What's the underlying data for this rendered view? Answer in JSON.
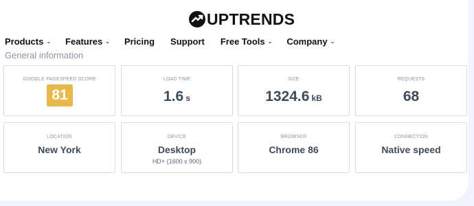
{
  "brand": {
    "name": "UPTRENDS"
  },
  "nav": {
    "items": [
      {
        "label": "Products",
        "dropdown": true
      },
      {
        "label": "Features",
        "dropdown": true
      },
      {
        "label": "Pricing",
        "dropdown": false
      },
      {
        "label": "Support",
        "dropdown": false
      },
      {
        "label": "Free Tools",
        "dropdown": true
      },
      {
        "label": "Company",
        "dropdown": true
      }
    ]
  },
  "section": {
    "title": "General information"
  },
  "metrics": {
    "pagespeed": {
      "label": "Google PageSpeed Score",
      "value": "81",
      "badge_color": "#e8b84a"
    },
    "load_time": {
      "label": "Load Time",
      "value": "1.6",
      "unit": "s"
    },
    "size": {
      "label": "Size",
      "value": "1324.6",
      "unit": "kB"
    },
    "requests": {
      "label": "Requests",
      "value": "68"
    },
    "location": {
      "label": "Location",
      "value": "New York"
    },
    "device": {
      "label": "Device",
      "value": "Desktop",
      "detail": "HD+ (1600 x 900)"
    },
    "browser": {
      "label": "Browser",
      "value": "Chrome 86"
    },
    "connection": {
      "label": "Connection",
      "value": "Native speed"
    }
  },
  "colors": {
    "value_text": "#3c4a5c",
    "label_text": "#8b95a1",
    "background": "#eef3fc"
  }
}
